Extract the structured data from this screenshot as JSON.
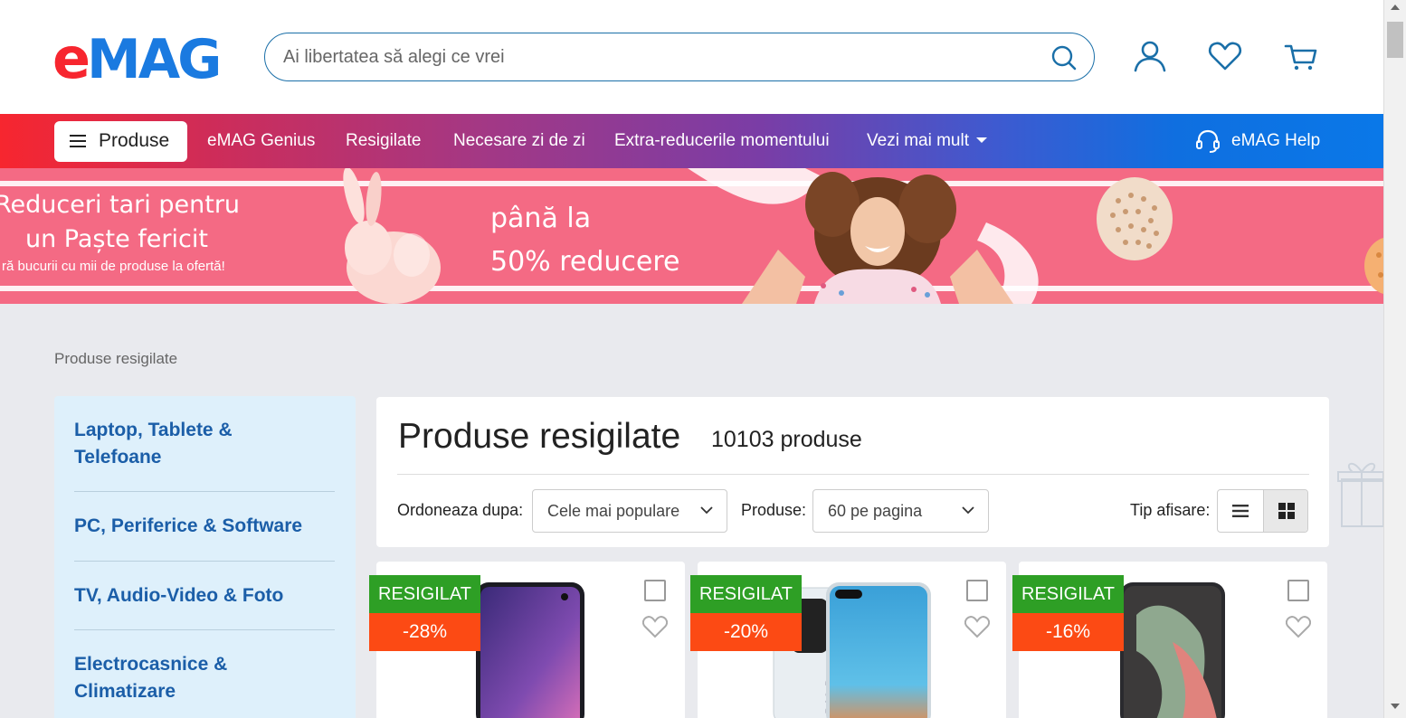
{
  "header": {
    "logo_text": "eMAG",
    "search_placeholder": "Ai libertatea să alegi ce vrei",
    "icons": [
      "search-icon",
      "account-icon",
      "favorites-icon",
      "cart-icon"
    ]
  },
  "nav": {
    "produse_label": "Produse",
    "items": [
      "eMAG Genius",
      "Resigilate",
      "Necesare zi de zi",
      "Extra-reducerile momentului",
      "Vezi mai mult"
    ],
    "help_label": "eMAG Help"
  },
  "banner": {
    "title_line1": "Reduceri tari pentru",
    "title_line2": "un Paște fericit",
    "subtitle": "ră bucurii cu mii de produse la ofertă!",
    "offer_line1": "până la",
    "offer_line2": "50% reducere"
  },
  "breadcrumb": "Produse resigilate",
  "sidebar": {
    "items": [
      {
        "line1": "Laptop, Tablete &",
        "line2": "Telefoane"
      },
      {
        "line1": "PC, Periferice & Software",
        "line2": ""
      },
      {
        "line1": "TV, Audio-Video & Foto",
        "line2": ""
      },
      {
        "line1": "Electrocasnice &",
        "line2": "Climatizare"
      }
    ]
  },
  "listing": {
    "title": "Produse resigilate",
    "count": "10103 produse",
    "sort_label": "Ordoneaza dupa:",
    "sort_value": "Cele mai populare",
    "per_page_label": "Produse:",
    "per_page_value": "60 pe pagina",
    "view_label": "Tip afisare:",
    "view_active": "grid"
  },
  "products": [
    {
      "tag": "RESIGILAT",
      "discount": "-28%"
    },
    {
      "tag": "RESIGILAT",
      "discount": "-20%"
    },
    {
      "tag": "RESIGILAT",
      "discount": "-16%"
    }
  ],
  "colors": {
    "brand_red": "#f7262f",
    "brand_blue": "#0a78e8",
    "link_blue": "#1b5ea8",
    "resigilat_green": "#2e9f25",
    "discount_orange": "#fc4a14"
  }
}
